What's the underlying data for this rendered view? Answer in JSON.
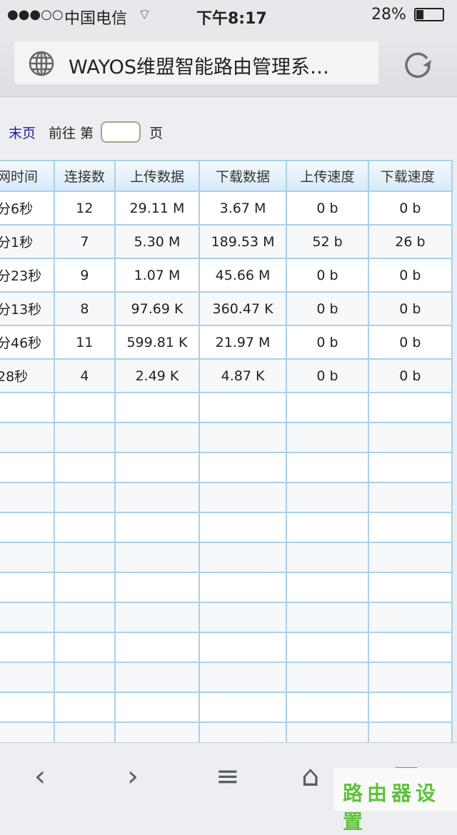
{
  "status": {
    "signal": "●●●○○",
    "carrier": "中国电信",
    "time": "下午8:17",
    "battery": "28%"
  },
  "browser": {
    "title": "WAYOS维盟智能路由管理系…"
  },
  "pager": {
    "last_page": "末页",
    "goto": "前往 第",
    "page_input": "",
    "page_suffix": "页"
  },
  "table": {
    "headers": [
      "网时间",
      "连接数",
      "上传数据",
      "下载数据",
      "上传速度",
      "下载速度"
    ],
    "rows": [
      [
        "分6秒",
        "12",
        "29.11 M",
        "3.67 M",
        "0 b",
        "0 b"
      ],
      [
        "分1秒",
        "7",
        "5.30 M",
        "189.53 M",
        "52 b",
        "26 b"
      ],
      [
        "分23秒",
        "9",
        "1.07 M",
        "45.66 M",
        "0 b",
        "0 b"
      ],
      [
        "分13秒",
        "8",
        "97.69 K",
        "360.47 K",
        "0 b",
        "0 b"
      ],
      [
        "分46秒",
        "11",
        "599.81 K",
        "21.97 M",
        "0 b",
        "0 b"
      ],
      [
        "28秒",
        "4",
        "2.49 K",
        "4.87 K",
        "0 b",
        "0 b"
      ]
    ]
  },
  "watermark": "路由器设置"
}
